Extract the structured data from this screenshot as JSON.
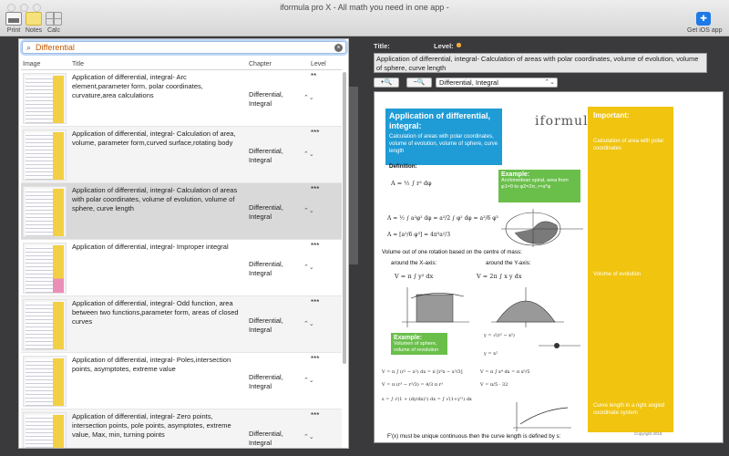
{
  "window": {
    "title": "iformula pro X - All math you need in one app -"
  },
  "toolbar": {
    "print_label": "Print",
    "notes_label": "Notes",
    "calc_label": "Calc",
    "ios_label": "Get iOS app"
  },
  "search": {
    "value": "Differential"
  },
  "table": {
    "headers": {
      "image": "Image",
      "title": "Title",
      "chapter": "Chapter",
      "level": "Level"
    },
    "rows": [
      {
        "title": "Application of differential, integral- Arc element,parameter form, polar coordinates, curvature,area calculations",
        "chapter": "Differential, Integral",
        "level": "**"
      },
      {
        "title": "Application of differential, integral- Calculation of area, volume, parameter form,curved surface,rotating body",
        "chapter": "Differential, Integral",
        "level": "***"
      },
      {
        "title": "Application of differential, integral- Calculation of areas with polar coordinates, volume of evolution, volume of sphere, curve length",
        "chapter": "Differential, Integral",
        "level": "***"
      },
      {
        "title": "Application of differential, integral- Improper integral",
        "chapter": "Differential, Integral",
        "level": "***"
      },
      {
        "title": "Application of differential, integral- Odd function, area between two functions,parameter form, areas of closed curves",
        "chapter": "Differential, Integral",
        "level": "***"
      },
      {
        "title": "Application of differential, integral- Poles,intersection points, asymptotes, extreme value",
        "chapter": "Differential, Integral",
        "level": "***"
      },
      {
        "title": "Application of differential, integral- Zero points, intersection points, pole points, asymptotes, extreme value, Max, min, turning points",
        "chapter": "Differential, Integral",
        "level": "***"
      }
    ]
  },
  "detail": {
    "title_label": "Title:",
    "level_label": "Level:",
    "level_dots": 3,
    "title_text": "Application of differential, integral- Calculation of areas with polar coordinates, volume of evolution, volume of sphere, curve length",
    "zoom_in": "+",
    "zoom_out": "−",
    "chapter_select": "Differential, Integral"
  },
  "document": {
    "heading": "Application of differential, integral:",
    "heading_sub": "Calculation of areas with polar coordinates, volume of evolution, volume of sphere, curve length",
    "logo": "iformula",
    "important_title": "Important:",
    "important_items": [
      "Calculation of area with polar coordinates",
      "Volume of  evolution",
      "Curve length in a right angled coordinate system"
    ],
    "definition_label": "Definition:",
    "example1_title": "Example:",
    "example1_text": "Archimedean spiral, area from φ1=0 to φ2=2π, r=a*φ",
    "volume_text": "Volume out of one rotation based on the centre of mass:",
    "around_x": "around the X-axis:",
    "around_y": "around the Y-axis:",
    "example2_title": "Example:",
    "example2_text": "Volumen of sphere, volume of revolution",
    "bottom_text": "F'(x) must be unique continuous then the curve length is defined by s:",
    "copyright": "Copyright 2018",
    "f_area": "A = ½ ∫ r² dφ",
    "f_vx": "V = π ∫ y² dx",
    "f_vy": "V = 2π ∫ x y dx"
  },
  "colors": {
    "accent_blue": "#1f9bd6",
    "accent_yellow": "#f0c40f",
    "accent_green": "#6abf4b",
    "search_text": "#c25a00",
    "level_dots": "#f2a93b"
  }
}
